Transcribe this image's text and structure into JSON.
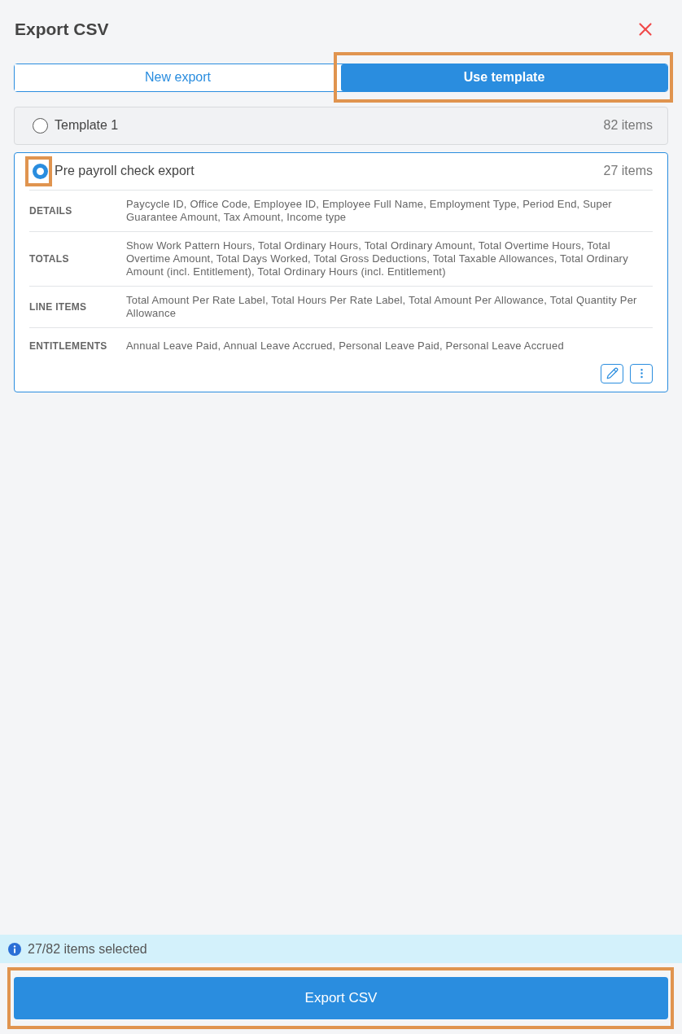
{
  "dialog": {
    "title": "Export CSV"
  },
  "tabs": [
    {
      "label": "New export",
      "selected": false,
      "highlighted": false
    },
    {
      "label": "Use template",
      "selected": true,
      "highlighted": true
    }
  ],
  "templates": [
    {
      "name": "Template 1",
      "count": "82 items",
      "selected": false,
      "highlighted": false
    },
    {
      "name": "Pre payroll check export",
      "count": "27 items",
      "selected": true,
      "highlighted": true,
      "details": [
        {
          "label": "DETAILS",
          "value": "Paycycle ID, Office Code, Employee ID, Employee Full Name, Employment Type, Period End, Super Guarantee Amount, Tax Amount, Income type"
        },
        {
          "label": "TOTALS",
          "value": "Show Work Pattern Hours, Total Ordinary Hours, Total Ordinary Amount, Total Overtime Hours, Total Overtime Amount, Total Days Worked, Total Gross Deductions, Total Taxable Allowances, Total Ordinary Amount (incl. Entitlement), Total Ordinary Hours (incl. Entitlement)"
        },
        {
          "label": "LINE ITEMS",
          "value": "Total Amount Per Rate Label, Total Hours Per Rate Label, Total Amount Per Allowance, Total Quantity Per Allowance"
        },
        {
          "label": "ENTITLEMENTS",
          "value": "Annual Leave Paid, Annual Leave Accrued, Personal Leave Paid, Personal Leave Accrued"
        }
      ]
    }
  ],
  "status": "27/82 items selected",
  "export_button": {
    "label": "Export CSV",
    "highlighted": true
  }
}
